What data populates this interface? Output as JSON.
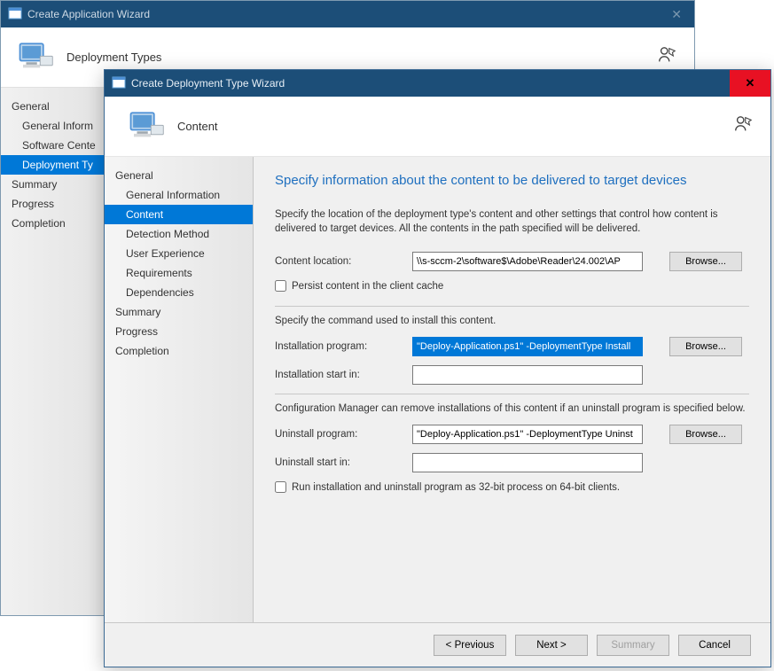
{
  "back_window": {
    "title": "Create Application Wizard",
    "header": "Deployment Types",
    "nav": [
      {
        "label": "General",
        "indent": false,
        "selected": false
      },
      {
        "label": "General Inform",
        "indent": true,
        "selected": false
      },
      {
        "label": "Software Cente",
        "indent": true,
        "selected": false
      },
      {
        "label": "Deployment Ty",
        "indent": true,
        "selected": true
      },
      {
        "label": "Summary",
        "indent": false,
        "selected": false
      },
      {
        "label": "Progress",
        "indent": false,
        "selected": false
      },
      {
        "label": "Completion",
        "indent": false,
        "selected": false
      }
    ]
  },
  "front_window": {
    "title": "Create Deployment Type Wizard",
    "header": "Content",
    "nav": [
      {
        "label": "General",
        "indent": false,
        "selected": false
      },
      {
        "label": "General Information",
        "indent": true,
        "selected": false
      },
      {
        "label": "Content",
        "indent": true,
        "selected": true
      },
      {
        "label": "Detection Method",
        "indent": true,
        "selected": false
      },
      {
        "label": "User Experience",
        "indent": true,
        "selected": false
      },
      {
        "label": "Requirements",
        "indent": true,
        "selected": false
      },
      {
        "label": "Dependencies",
        "indent": true,
        "selected": false
      },
      {
        "label": "Summary",
        "indent": false,
        "selected": false
      },
      {
        "label": "Progress",
        "indent": false,
        "selected": false
      },
      {
        "label": "Completion",
        "indent": false,
        "selected": false
      }
    ],
    "content": {
      "heading": "Specify information about the content to be delivered to target devices",
      "desc": "Specify the location of the deployment type's content and other settings that control how content is delivered to target devices. All the contents in the path specified will be delivered.",
      "content_location_label": "Content location:",
      "content_location_value": "\\\\s-sccm-2\\software$\\Adobe\\Reader\\24.002\\AP",
      "browse": "Browse...",
      "persist_label": "Persist content in the client cache",
      "install_cmd_text": "Specify the command used to install this content.",
      "install_program_label": "Installation program:",
      "install_program_value": "\"Deploy-Application.ps1\" -DeploymentType Install",
      "install_startin_label": "Installation start in:",
      "install_startin_value": "",
      "uninstall_text": "Configuration Manager can remove installations of this content if an uninstall program is specified below.",
      "uninstall_program_label": "Uninstall program:",
      "uninstall_program_value": "\"Deploy-Application.ps1\" -DeploymentType Uninst",
      "uninstall_startin_label": "Uninstall start in:",
      "uninstall_startin_value": "",
      "run32_label": "Run installation and uninstall program as 32-bit process on 64-bit clients."
    },
    "footer": {
      "previous": "< Previous",
      "next": "Next >",
      "summary": "Summary",
      "cancel": "Cancel"
    }
  }
}
